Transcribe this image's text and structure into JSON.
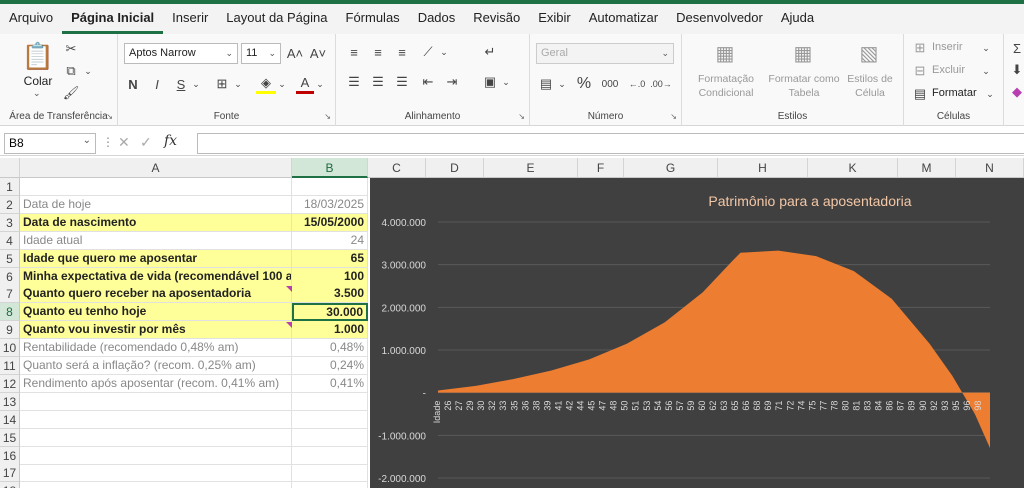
{
  "menu": [
    "Arquivo",
    "Página Inicial",
    "Inserir",
    "Layout da Página",
    "Fórmulas",
    "Dados",
    "Revisão",
    "Exibir",
    "Automatizar",
    "Desenvolvedor",
    "Ajuda"
  ],
  "active_tab": "Página Inicial",
  "ribbon": {
    "clipboard": {
      "paste_label": "Colar",
      "group_label": "Área de Transferência"
    },
    "font": {
      "family": "Aptos Narrow",
      "size": "11",
      "group_label": "Fonte",
      "bold": "N",
      "italic": "I",
      "underline": "S",
      "font_color_letter": "A",
      "grow": "A˄",
      "shrink": "A˅"
    },
    "alignment": {
      "group_label": "Alinhamento"
    },
    "number": {
      "format": "Geral",
      "group_label": "Número",
      "percent": "%",
      "thousands": "000"
    },
    "styles": {
      "conditional": "Formatação Condicional",
      "table": "Formatar como Tabela",
      "cell_styles": "Estilos de Célula",
      "group_label": "Estilos"
    },
    "cells": {
      "insert": "Inserir",
      "delete": "Excluir",
      "format": "Formatar",
      "group_label": "Células"
    }
  },
  "formula_bar": {
    "name_box": "B8",
    "fx": "fx",
    "content": ""
  },
  "columns": [
    "A",
    "B",
    "C",
    "D",
    "E",
    "F",
    "G",
    "H",
    "K",
    "M",
    "N"
  ],
  "selected_column": "B",
  "selected_row": "8",
  "rows": [
    {
      "n": "1",
      "a": "",
      "b": ""
    },
    {
      "n": "2",
      "a": "Data de hoje",
      "b": "18/03/2025"
    },
    {
      "n": "3",
      "a": "Data de nascimento",
      "b": "15/05/2000"
    },
    {
      "n": "4",
      "a": "Idade atual",
      "b": "24"
    },
    {
      "n": "5",
      "a": "Idade que quero me aposentar",
      "b": "65"
    },
    {
      "n": "6",
      "a": "Minha expectativa de vida (recomendável 100 a",
      "b": "100"
    },
    {
      "n": "7",
      "a": "Quanto quero receber na aposentadoria",
      "b": "3.500"
    },
    {
      "n": "8",
      "a": "Quanto eu tenho hoje",
      "b": "30.000"
    },
    {
      "n": "9",
      "a": "Quanto vou investir por mês",
      "b": "1.000"
    },
    {
      "n": "10",
      "a": "Rentabilidade (recomendado 0,48% am)",
      "b": "0,48%"
    },
    {
      "n": "11",
      "a": "Quanto será a inflação? (recom. 0,25% am)",
      "b": "0,24%"
    },
    {
      "n": "12",
      "a": "Rendimento após aposentar (recom. 0,41% am)",
      "b": "0,41%"
    },
    {
      "n": "13",
      "a": "",
      "b": ""
    },
    {
      "n": "14",
      "a": "",
      "b": ""
    },
    {
      "n": "15",
      "a": "",
      "b": ""
    },
    {
      "n": "16",
      "a": "",
      "b": ""
    },
    {
      "n": "17",
      "a": "",
      "b": ""
    },
    {
      "n": "18",
      "a": "",
      "b": ""
    }
  ],
  "colors": {
    "accent": "#1e7145",
    "highlight": "#ffff99",
    "chart_bg": "#404040",
    "series": "#ed7d31",
    "title": "#f4c7a6",
    "comment": "#b83fb0"
  },
  "chart_data": {
    "type": "area",
    "title": "Patrimônio para a aposentadoria",
    "xlabel": "",
    "ylabel": "",
    "first_tick_label": "Idade",
    "x": [
      25,
      30,
      35,
      40,
      45,
      50,
      55,
      60,
      64,
      65,
      70,
      75,
      80,
      85,
      90,
      93,
      95,
      96,
      98
    ],
    "values": [
      50000,
      160000,
      320000,
      520000,
      780000,
      1150000,
      1650000,
      2350000,
      3100000,
      3280000,
      3330000,
      3200000,
      2850000,
      2200000,
      1150000,
      400000,
      -200000,
      -500000,
      -1300000
    ],
    "tick_labels": [
      "26",
      "27",
      "29",
      "30",
      "32",
      "33",
      "35",
      "36",
      "38",
      "39",
      "41",
      "42",
      "44",
      "45",
      "47",
      "48",
      "50",
      "51",
      "53",
      "54",
      "56",
      "57",
      "59",
      "60",
      "62",
      "63",
      "65",
      "66",
      "68",
      "69",
      "71",
      "72",
      "74",
      "75",
      "77",
      "78",
      "80",
      "81",
      "83",
      "84",
      "86",
      "87",
      "89",
      "90",
      "92",
      "93",
      "95",
      "96",
      "98"
    ],
    "y_ticks": [
      "4.000.000",
      "3.000.000",
      "2.000.000",
      "1.000.000",
      "-",
      "-1.000.000",
      "-2.000.000"
    ],
    "y_tick_values": [
      4000000,
      3000000,
      2000000,
      1000000,
      0,
      -1000000,
      -2000000
    ],
    "ylim": [
      -2000000,
      4000000
    ],
    "grid": true,
    "legend": "none"
  }
}
